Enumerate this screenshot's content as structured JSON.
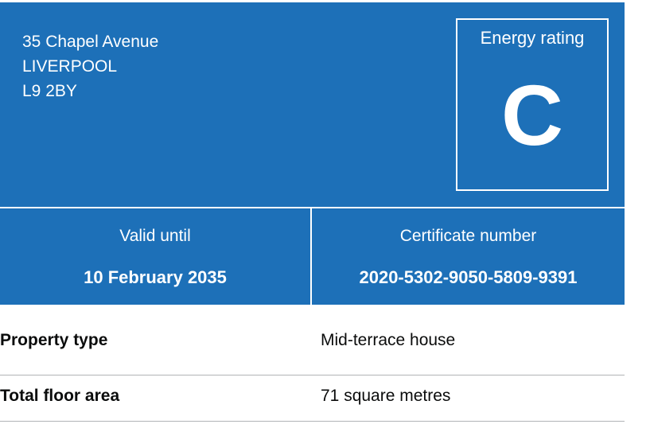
{
  "address": {
    "line1": "35 Chapel Avenue",
    "line2": "LIVERPOOL",
    "postcode": "L9 2BY"
  },
  "energy_rating": {
    "label": "Energy rating",
    "value": "C"
  },
  "valid_until": {
    "label": "Valid until",
    "value": "10 February 2035"
  },
  "certificate": {
    "label": "Certificate number",
    "value": "2020-5302-9050-5809-9391"
  },
  "summary": [
    {
      "key": "Property type",
      "value": "Mid-terrace house"
    },
    {
      "key": "Total floor area",
      "value": "71 square metres"
    }
  ],
  "colors": {
    "panel": "#1d70b8",
    "text_on_panel": "#ffffff",
    "divider": "#b1b4b6"
  }
}
